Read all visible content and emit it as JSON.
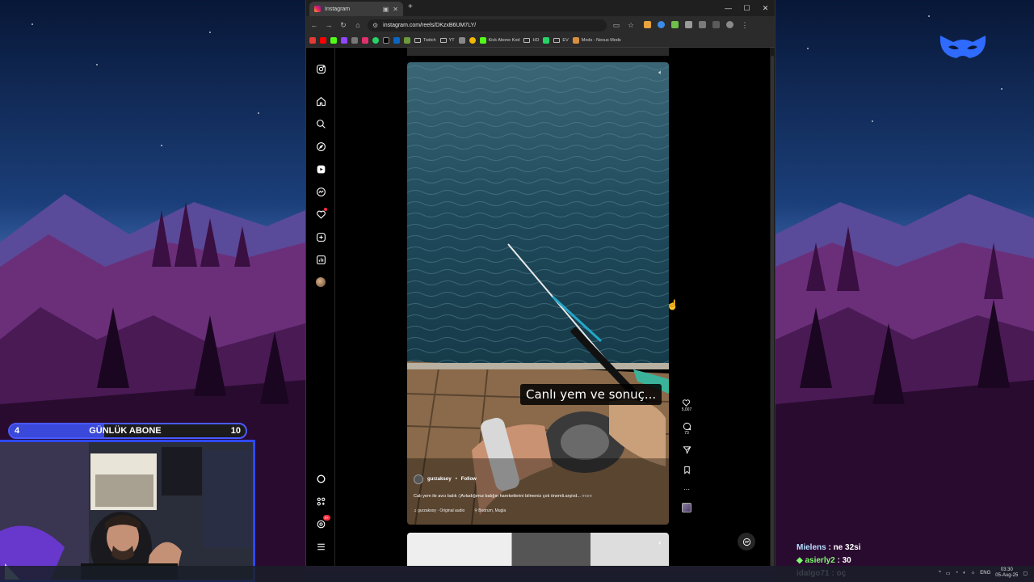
{
  "browser": {
    "tab_title": "Instagram",
    "url": "instagram.com/reels/DKzxB6UM7LY/",
    "bookmarks": [
      "Twitch",
      "YT",
      "Kick Abone Kod",
      "HD",
      "EV",
      "Mods - Nexus Mods"
    ]
  },
  "reel": {
    "caption_overlay": "Canlı yem ve sonuç...",
    "username": "gurzaksoy",
    "follow_label": "Follow",
    "description": "Calı yem ile avcı balık :)Avladığımız balığın hareketlerini bilmeniz çok önemli.arşivd...",
    "more_label": "more",
    "audio": "gurzaksoy · Original audio",
    "location": "Bodrum, Mugla",
    "likes": "5,007",
    "comments": "73"
  },
  "sidebar": {
    "notif_badge": "9+"
  },
  "overlay": {
    "sub_current": "4",
    "sub_label": "GÜNLÜK ABONE",
    "sub_goal": "10",
    "sub_progress": 0.4
  },
  "chat": [
    {
      "user": "Mielens",
      "msg": "ne 32si"
    },
    {
      "user": "asierly2",
      "msg": "30"
    },
    {
      "user": "idalgo71",
      "msg": "oç"
    }
  ],
  "tray": {
    "lang": "ENG",
    "time": "03:30",
    "date": "05-Aug-25"
  },
  "colors": {
    "accent": "#2f49ff",
    "instagram_bg": "#000000",
    "sea": "#1f4a5c"
  }
}
